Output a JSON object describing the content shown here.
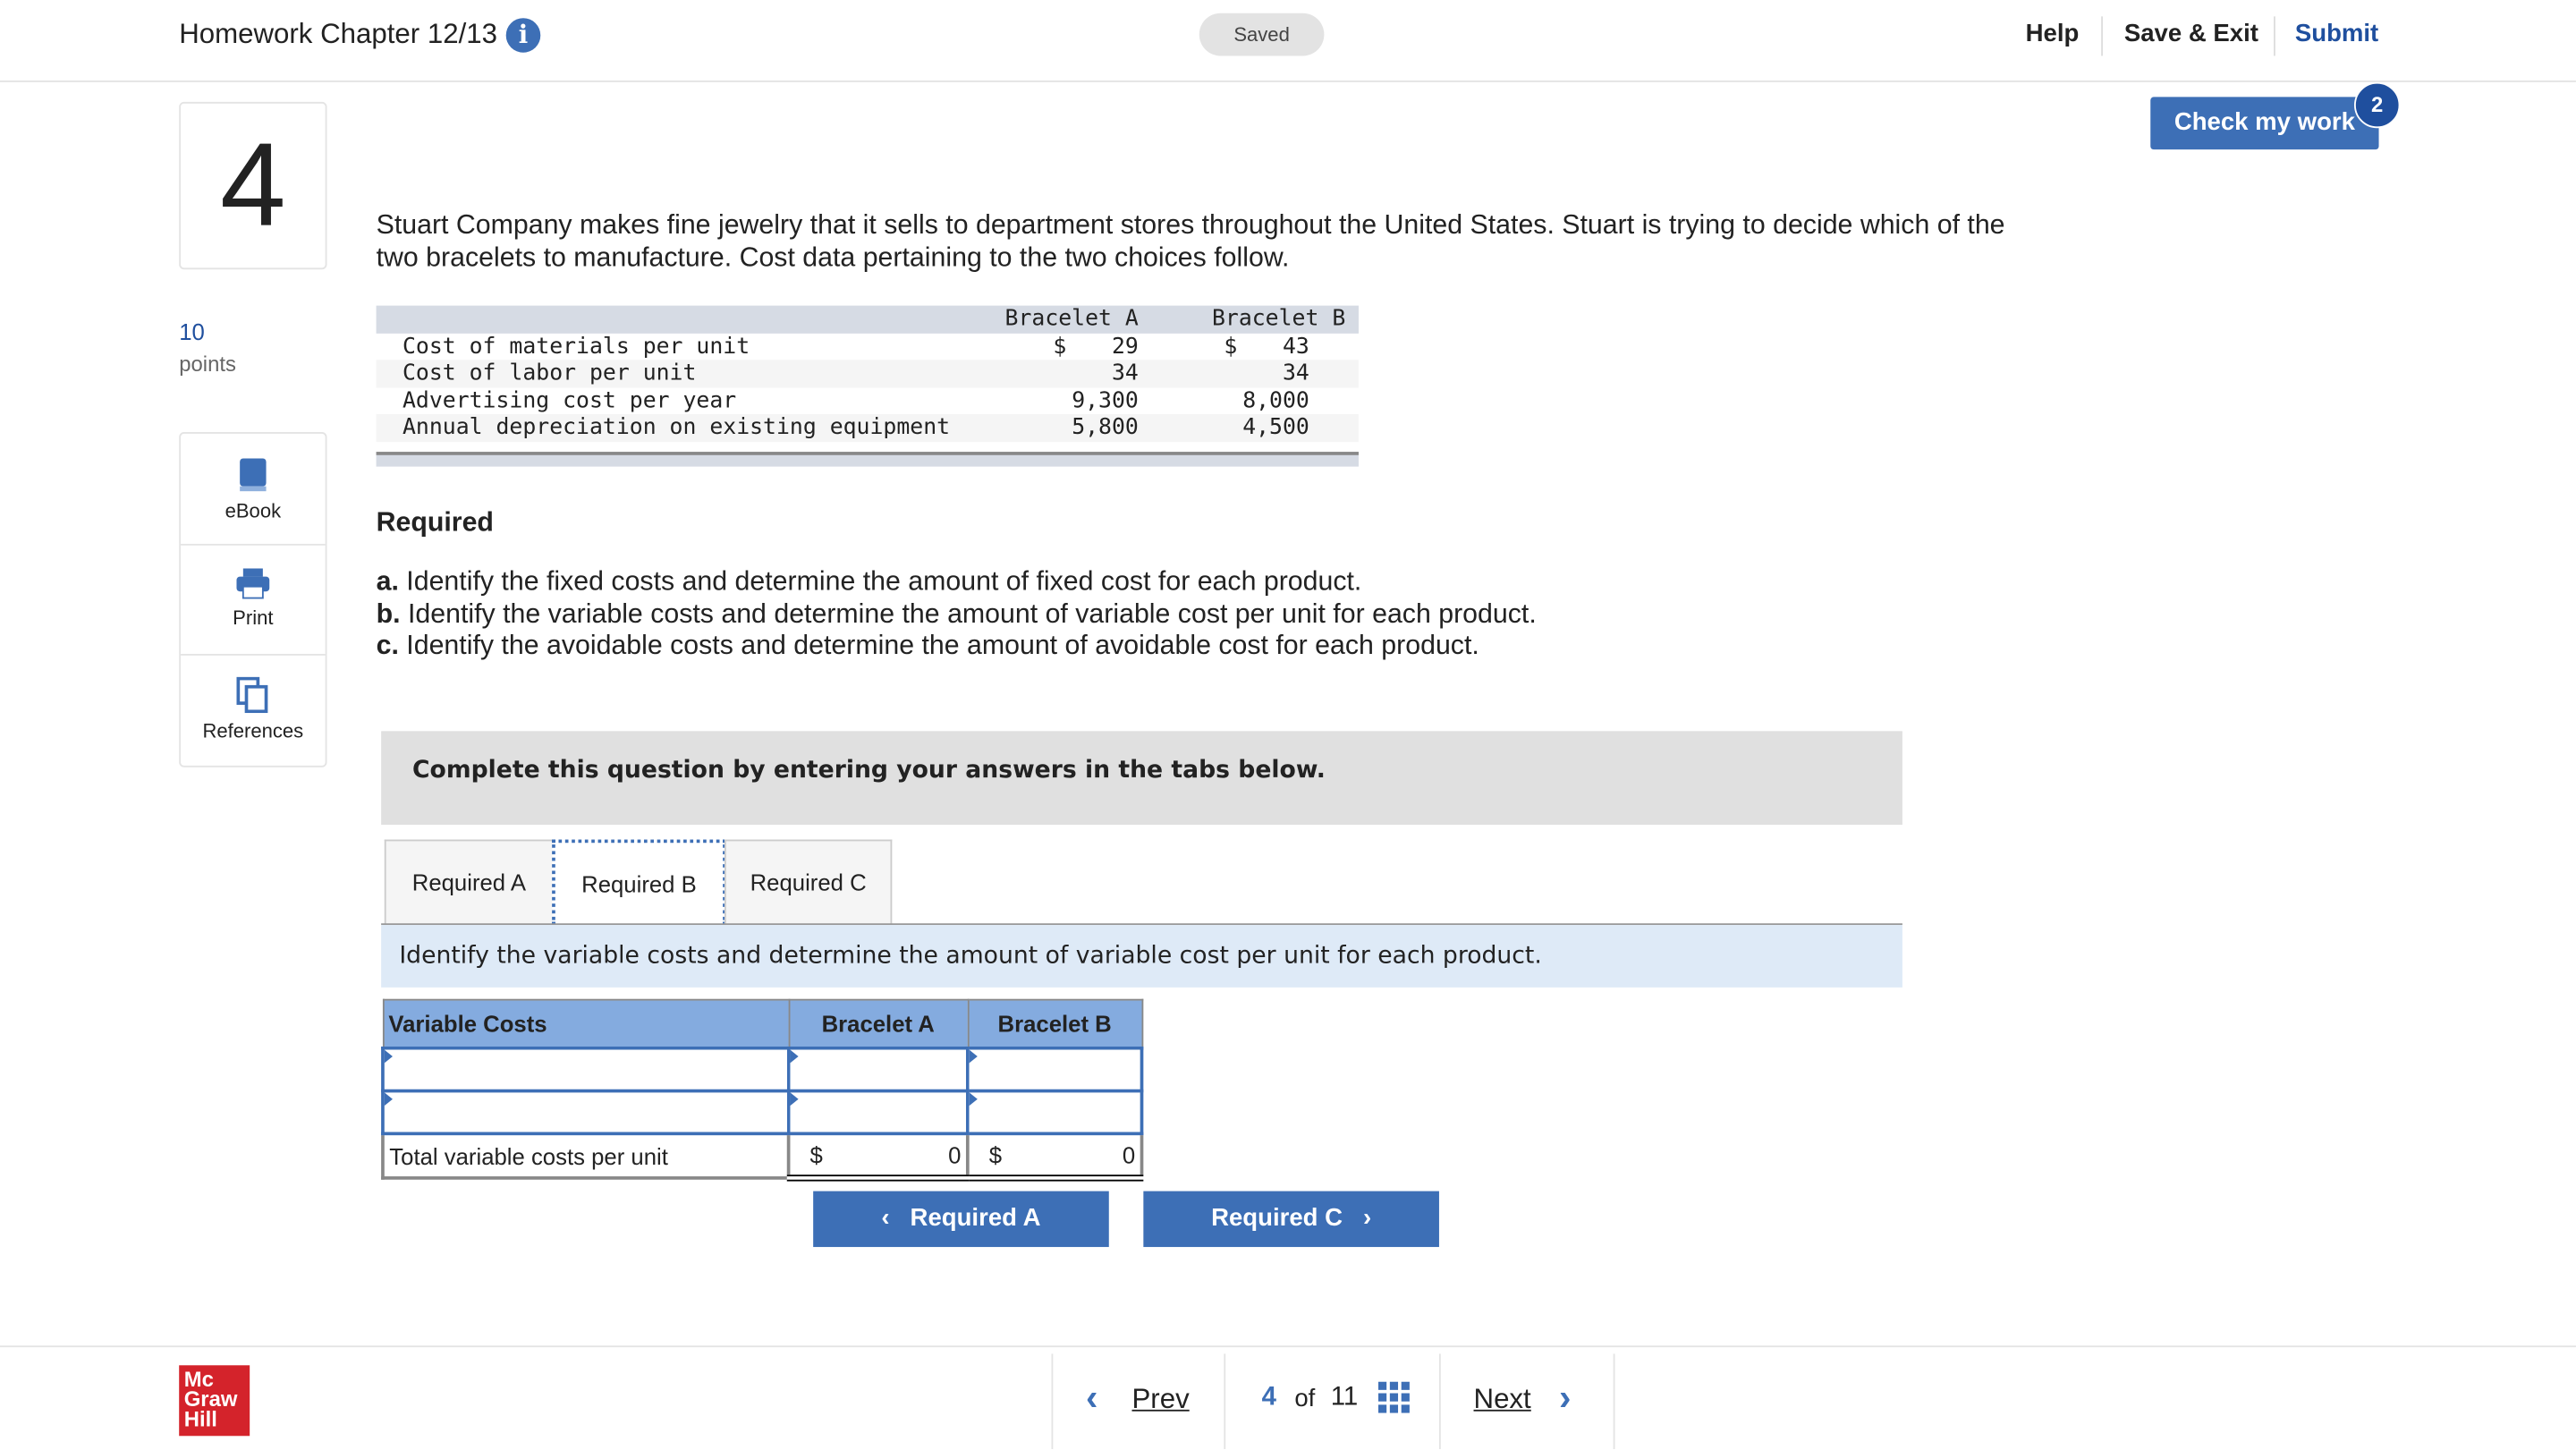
{
  "header": {
    "title": "Homework Chapter 12/13",
    "saved": "Saved",
    "help": "Help",
    "save_exit": "Save & Exit",
    "submit": "Submit"
  },
  "question": {
    "number": "4",
    "points": "10",
    "points_label": "points"
  },
  "tools": [
    {
      "label": "eBook",
      "icon": "book-icon"
    },
    {
      "label": "Print",
      "icon": "printer-icon"
    },
    {
      "label": "References",
      "icon": "copy-icon"
    }
  ],
  "check": {
    "label": "Check my work",
    "badge": "2"
  },
  "problem": "Stuart Company makes fine jewelry that it sells to department stores throughout the United States. Stuart is trying to decide which of the two bracelets to manufacture. Cost data pertaining to the two choices follow.",
  "data_table": {
    "headers": [
      "Bracelet A",
      "Bracelet B"
    ],
    "rows": [
      {
        "label": "Cost of materials per unit",
        "a": "29",
        "b": "43",
        "dollar": "$"
      },
      {
        "label": "Cost of labor per unit",
        "a": "34",
        "b": "34"
      },
      {
        "label": "Advertising cost per year",
        "a": "9,300",
        "b": "8,000"
      },
      {
        "label": "Annual depreciation on existing equipment",
        "a": "5,800",
        "b": "4,500"
      }
    ]
  },
  "required": {
    "title": "Required",
    "items": [
      {
        "letter": "a.",
        "text": " Identify the fixed costs and determine the amount of fixed cost for each product."
      },
      {
        "letter": "b.",
        "text": " Identify the variable costs and determine the amount of variable cost per unit for each product."
      },
      {
        "letter": "c.",
        "text": " Identify the avoidable costs and determine the amount of avoidable cost for each product."
      }
    ]
  },
  "banner": "Complete this question by entering your answers in the tabs below.",
  "tabs": [
    "Required A",
    "Required B",
    "Required C"
  ],
  "active_tab": "Required B",
  "instruction": "Identify the variable costs and determine the amount of variable cost per unit for each product.",
  "answer_table": {
    "headers": [
      "Variable Costs",
      "Bracelet A",
      "Bracelet B"
    ],
    "total_label": "Total variable costs per unit",
    "dollar": "$",
    "total_a": "0",
    "total_b": "0"
  },
  "nav": {
    "prev_req": "Required A",
    "next_req": "Required C"
  },
  "footer": {
    "logo": "Mc Graw Hill",
    "prev": "Prev",
    "page": "4",
    "of": "of",
    "total": "11",
    "next": "Next"
  }
}
